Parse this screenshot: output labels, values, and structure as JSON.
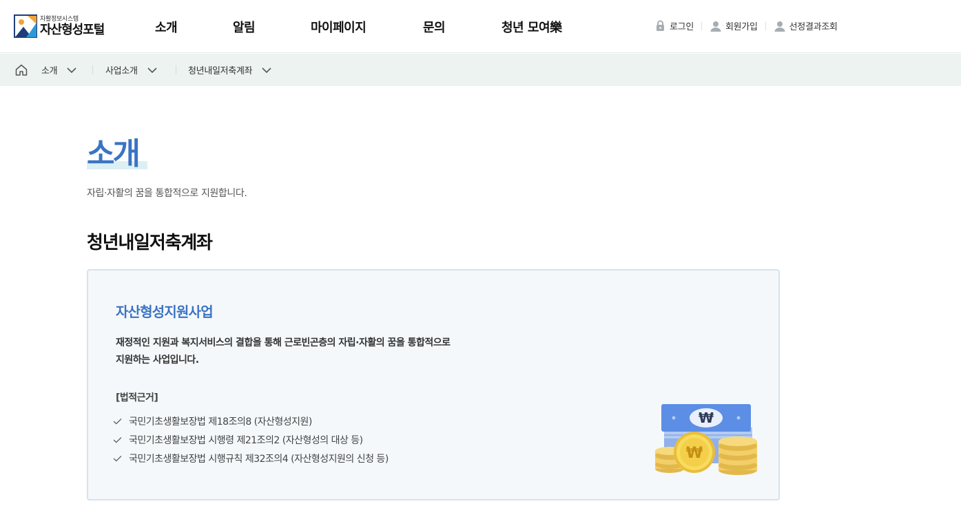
{
  "header": {
    "logo_sub": "자활정보시스템",
    "logo_main": "자산형성포털",
    "nav": [
      {
        "label": "소개"
      },
      {
        "label": "알림"
      },
      {
        "label": "마이페이지"
      },
      {
        "label": "문의"
      },
      {
        "label": "청년 모여樂"
      }
    ],
    "util": {
      "login": "로그인",
      "signup": "회원가입",
      "result": "선정결과조회"
    }
  },
  "breadcrumb": {
    "items": [
      {
        "label": "소개"
      },
      {
        "label": "사업소개"
      },
      {
        "label": "청년내일저축계좌"
      }
    ]
  },
  "main": {
    "title": "소개",
    "description": "자립·자활의 꿈을 통합적으로 지원합니다.",
    "section_title": "청년내일저축계좌",
    "card": {
      "title": "자산형성지원사업",
      "desc_line1": "재정적인 지원과 복지서비스의 결합을 통해 근로빈곤층의 자립·자활의 꿈을 통합적으로",
      "desc_line2": "지원하는 사업입니다.",
      "legal_title": "[법적근거]",
      "legal_items": [
        "국민기초생활보장법 제18조의8 (자산형성지원)",
        "국민기초생활보장법 시행령 제21조의2 (자산형성의 대상 등)",
        "국민기초생활보장법 시행규칙 제32조의4 (자산형성지원의 신청 등)"
      ]
    }
  },
  "colors": {
    "accent": "#3a74c4",
    "breadcrumb_bg": "#edf3f1",
    "card_bg": "#f5f8fb",
    "card_border": "#d7e2ec"
  },
  "icons": {
    "logo": "portal-logo-icon",
    "lock": "lock-icon",
    "user": "user-icon",
    "home": "home-icon",
    "chevron": "chevron-down-icon",
    "check": "check-icon",
    "money": "money-illustration"
  }
}
